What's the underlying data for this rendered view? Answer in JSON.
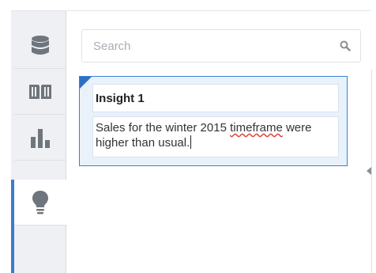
{
  "rail": {
    "items": [
      {
        "icon": "database-icon",
        "active": false
      },
      {
        "icon": "book-icon",
        "active": false
      },
      {
        "icon": "bar-chart-icon",
        "active": false
      },
      {
        "icon": "lightbulb-icon",
        "active": true
      }
    ]
  },
  "search": {
    "placeholder": "Search",
    "value": ""
  },
  "insight": {
    "title": "Insight 1",
    "body_before": "Sales for the winter 2015 ",
    "body_misspelled": "timeframe",
    "body_after": " were higher than usual."
  },
  "colors": {
    "accent": "#3d7cc9",
    "card_background": "#e9f2fb",
    "rail_background": "#eef0f3",
    "icon": "#6f757c"
  }
}
